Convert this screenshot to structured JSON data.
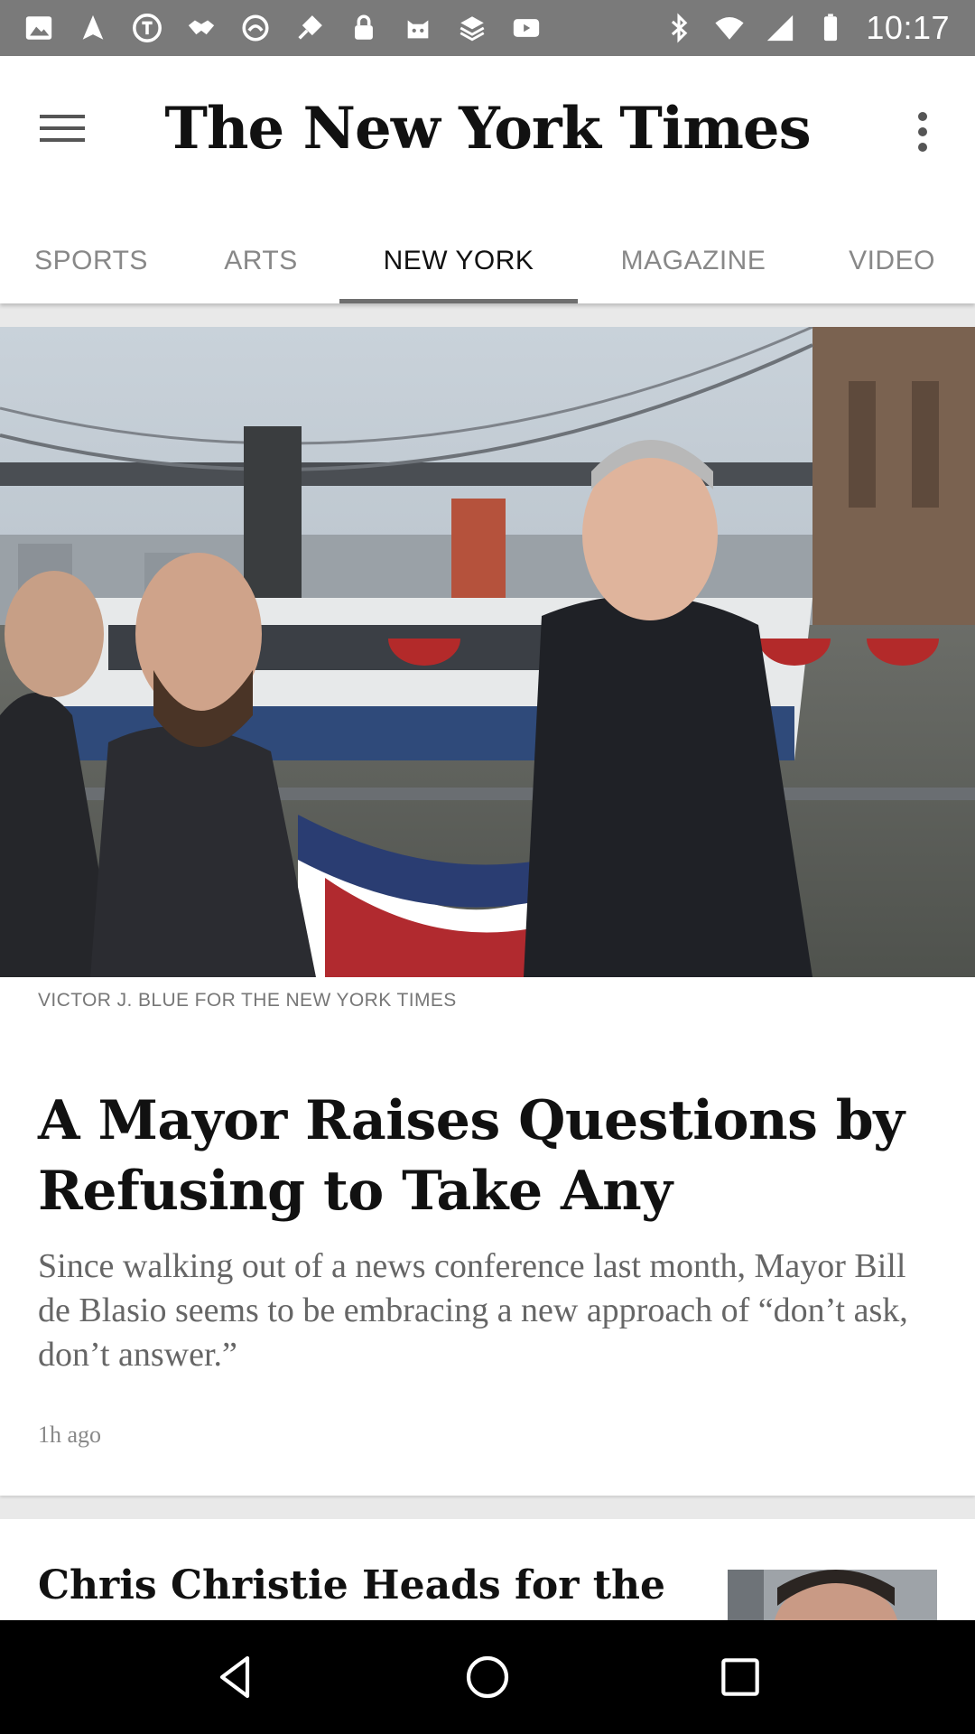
{
  "status_bar": {
    "time": "10:17",
    "left_icons": [
      "image-icon",
      "navigation-icon",
      "music-icon",
      "handshake-icon",
      "cloud-icon",
      "satellite-icon",
      "lock-icon",
      "cat-icon",
      "checklist-icon",
      "youtube-icon"
    ],
    "right_icons": [
      "bluetooth-icon",
      "wifi-icon",
      "signal-icon",
      "battery-icon"
    ]
  },
  "header": {
    "masthead": "The New York Times"
  },
  "tabs": [
    {
      "label": "SPORTS",
      "active": false
    },
    {
      "label": "ARTS",
      "active": false
    },
    {
      "label": "NEW YORK",
      "active": true
    },
    {
      "label": "MAGAZINE",
      "active": false
    },
    {
      "label": "VIDEO",
      "active": false
    }
  ],
  "article": {
    "photo_credit": "VICTOR J. BLUE FOR THE NEW YORK TIMES",
    "headline": "A Mayor Raises Questions by Refusing to Take Any",
    "summary": "Since walking out of a news conference last month, Mayor Bill de Blasio seems to be embracing a new approach of “don’t ask, don’t answer.”",
    "time_ago": "1h ago"
  },
  "next_article": {
    "headline": "Chris Christie Heads for the"
  },
  "colors": {
    "status_bar": "#7a7a7a",
    "active_tab_indicator": "#6f6f6f",
    "background": "#e9e9e9"
  }
}
